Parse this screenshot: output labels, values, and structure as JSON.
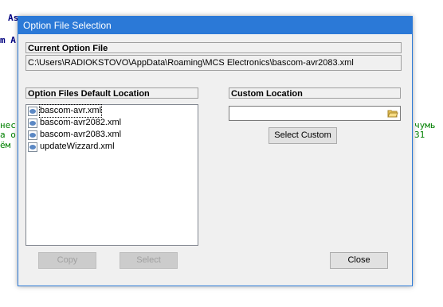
{
  "window": {
    "title": "Option File Selection"
  },
  "current_option_file": {
    "label": "Current Option File",
    "path": "C:\\Users\\RADIOKSTOVO\\AppData\\Roaming\\MCS Electronics\\bascom-avr2083.xml"
  },
  "default_location": {
    "label": "Option Files Default Location",
    "files": [
      "bascom-avr.xml",
      "bascom-avr2082.xml",
      "bascom-avr2083.xml",
      "updateWizzard.xml"
    ],
    "selected_index": 0
  },
  "custom_location": {
    "label": "Custom Location",
    "value": "",
    "select_custom_label": "Select Custom"
  },
  "buttons": {
    "copy": "Copy",
    "select": "Select",
    "close": "Close"
  },
  "background_fragments": {
    "line1": "As",
    "line2": "m A",
    "line3": "нес",
    "line4": "a o",
    "line5": "ём",
    "right1": "чумь",
    "right2": "31"
  }
}
